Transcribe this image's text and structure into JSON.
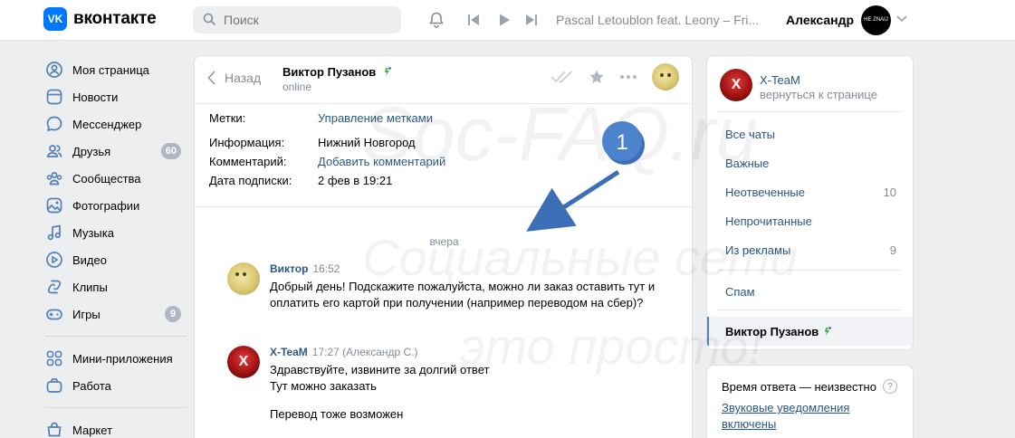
{
  "header": {
    "logo_mark": "VK",
    "logo_text": "вконтакте",
    "search_placeholder": "Поиск",
    "player_title": "Pascal Letoublon feat. Leony – Fri...",
    "user_name": "Александр",
    "avatar_text": "HE ZNAIJ"
  },
  "nav": {
    "items": [
      {
        "label": "Моя страница",
        "icon": "user-icon"
      },
      {
        "label": "Новости",
        "icon": "news-icon"
      },
      {
        "label": "Мессенджер",
        "icon": "message-icon"
      },
      {
        "label": "Друзья",
        "icon": "friends-icon",
        "badge": "60"
      },
      {
        "label": "Сообщества",
        "icon": "groups-icon"
      },
      {
        "label": "Фотографии",
        "icon": "photo-icon"
      },
      {
        "label": "Музыка",
        "icon": "music-icon"
      },
      {
        "label": "Видео",
        "icon": "video-icon"
      },
      {
        "label": "Клипы",
        "icon": "clips-icon"
      },
      {
        "label": "Игры",
        "icon": "games-icon",
        "badge": "9"
      }
    ],
    "items2": [
      {
        "label": "Мини-приложения",
        "icon": "apps-icon"
      },
      {
        "label": "Работа",
        "icon": "work-icon"
      }
    ],
    "items3": [
      {
        "label": "Маркет",
        "icon": "market-icon"
      }
    ]
  },
  "chat": {
    "back_label": "Назад",
    "peer_name": "Виктор Пузанов",
    "peer_status": "online",
    "info": [
      {
        "key": "Метки:",
        "value": "Управление метками",
        "link": true
      },
      {
        "key": "Информация:",
        "value": "Нижний Новгород",
        "link": false
      },
      {
        "key": "Комментарий:",
        "value": "Добавить комментарий",
        "link": true
      },
      {
        "key": "Дата подписки:",
        "value": "2 фев в 19:21",
        "link": false
      }
    ],
    "day_label": "вчера",
    "messages": [
      {
        "author": "Виктор",
        "time": "16:52",
        "lines": [
          "Добрый день! Подскажите пожалуйста, можно ли заказ оставить тут и оплатить его картой при получении (например переводом на сбер)?"
        ]
      },
      {
        "author": "X-TeaM",
        "time": "17:27 (Александр С.)",
        "lines": [
          "Здравствуйте, извините за долгий ответ",
          "Тут можно заказать",
          "Перевод тоже возможен"
        ]
      }
    ]
  },
  "right": {
    "community_name": "X-TeaM",
    "community_back": "вернуться к странице",
    "avatar_text": "X",
    "folders": [
      {
        "label": "Все чаты",
        "count": ""
      },
      {
        "label": "Важные",
        "count": ""
      },
      {
        "label": "Неотвеченные",
        "count": "10"
      },
      {
        "label": "Непрочитанные",
        "count": ""
      },
      {
        "label": "Из рекламы",
        "count": "9"
      }
    ],
    "spam_label": "Спам",
    "active_chat": "Виктор Пузанов",
    "response_time": "Время ответа — неизвестно",
    "help_mark": "?",
    "sound_notice": "Звуковые уведомления включены"
  },
  "annotation": {
    "number": "1",
    "color": "#3d6fb6"
  },
  "watermark": {
    "line1": "Soc-FAQ.ru",
    "line2": "Социальные сети",
    "line3": "это просто!"
  }
}
